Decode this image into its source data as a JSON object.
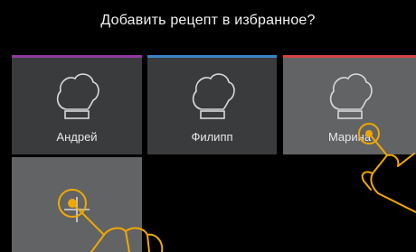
{
  "dialog": {
    "title": "Добавить рецепт в избранное?"
  },
  "profiles": [
    {
      "name": "Андрей",
      "accent": "#8e3a9e",
      "icon": "chef-hat-icon"
    },
    {
      "name": "Филипп",
      "accent": "#3b82c4",
      "icon": "chef-hat-icon"
    },
    {
      "name": "Марина",
      "accent": "#d34444",
      "icon": "chef-hat-icon",
      "selected": true
    }
  ],
  "add_profile": {
    "icon": "plus-icon"
  },
  "gesture_color": "#f0a800"
}
